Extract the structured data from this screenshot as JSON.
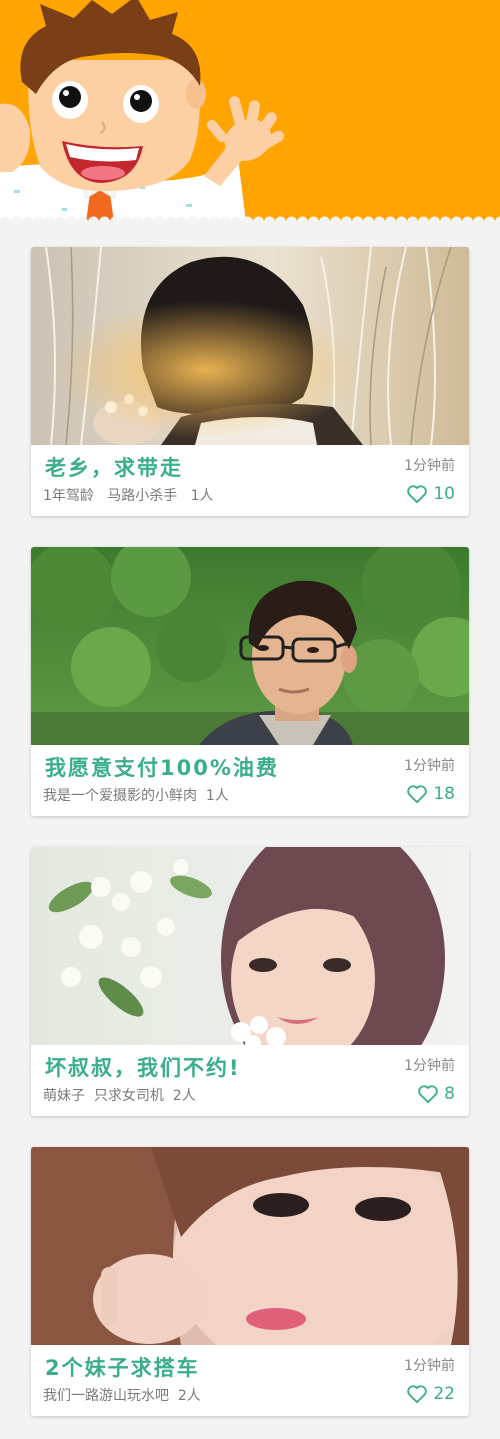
{
  "theme": {
    "header_bg": "#ffa400",
    "accent": "#3aae8c"
  },
  "header": {
    "illustration": "waving-cartoon-man"
  },
  "cards": [
    {
      "title": "老乡，求带走",
      "subtitle": "1年驾龄   马路小杀手   1人",
      "time": "1分钟前",
      "likes": "10",
      "icon": "heart-outline-icon"
    },
    {
      "title": "我愿意支付100%油费",
      "subtitle": "我是一个爱摄影的小鲜肉  1人",
      "time": "1分钟前",
      "likes": "18",
      "icon": "heart-outline-icon"
    },
    {
      "title": "坏叔叔，我们不约!",
      "subtitle": "萌妹子  只求女司机  2人",
      "time": "1分钟前",
      "likes": "8",
      "icon": "heart-outline-icon"
    },
    {
      "title": "2个妹子求搭车",
      "subtitle": "我们一路游山玩水吧  2人",
      "time": "1分钟前",
      "likes": "22",
      "icon": "heart-outline-icon"
    }
  ]
}
